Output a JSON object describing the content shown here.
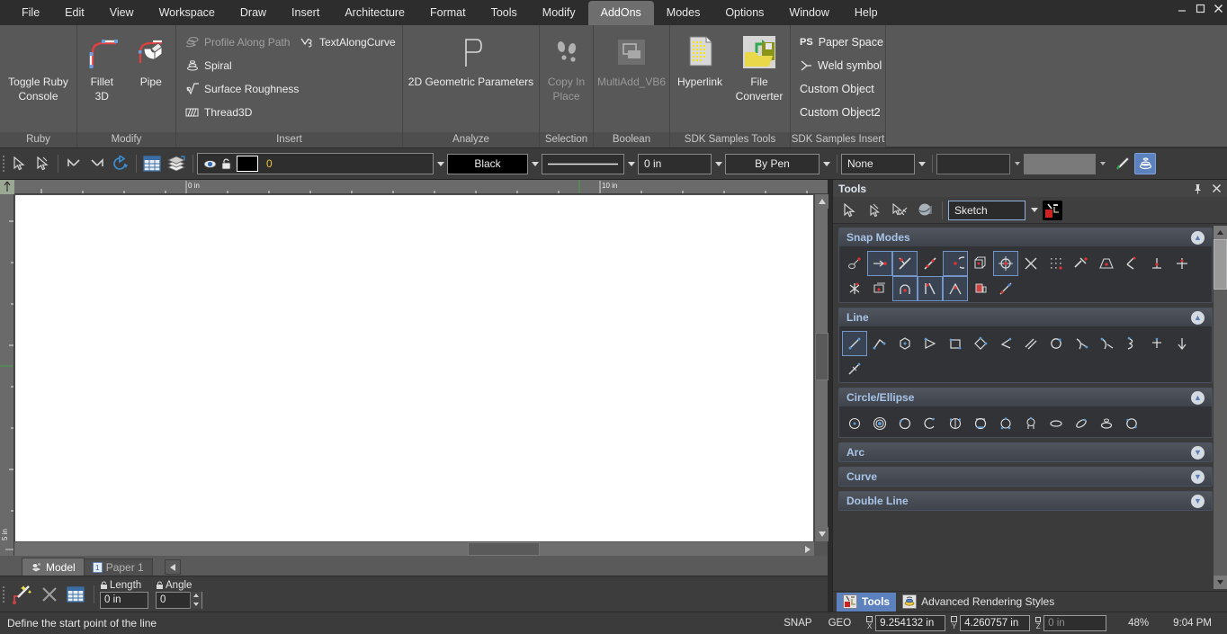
{
  "window": {
    "controls": [
      "minimize",
      "maximize",
      "close"
    ]
  },
  "menubar": {
    "items": [
      {
        "label": "File",
        "active": false
      },
      {
        "label": "Edit",
        "active": false
      },
      {
        "label": "View",
        "active": false
      },
      {
        "label": "Workspace",
        "active": false
      },
      {
        "label": "Draw",
        "active": false
      },
      {
        "label": "Insert",
        "active": false
      },
      {
        "label": "Architecture",
        "active": false
      },
      {
        "label": "Format",
        "active": false
      },
      {
        "label": "Tools",
        "active": false
      },
      {
        "label": "Modify",
        "active": false
      },
      {
        "label": "AddOns",
        "active": true
      },
      {
        "label": "Modes",
        "active": false
      },
      {
        "label": "Options",
        "active": false
      },
      {
        "label": "Window",
        "active": false
      },
      {
        "label": "Help",
        "active": false
      }
    ]
  },
  "ribbon": {
    "groups": [
      {
        "name": "Ruby",
        "label": "Ruby",
        "buttons": [
          {
            "label_line1": "Toggle Ruby",
            "label_line2": "Console",
            "icon": "ruby-console-icon",
            "enabled": true
          }
        ]
      },
      {
        "name": "Modify",
        "label": "Modify",
        "buttons": [
          {
            "label_line1": "Fillet",
            "label_line2": "3D",
            "icon": "fillet-3d-icon",
            "enabled": true
          },
          {
            "label_line1": "Pipe",
            "label_line2": "",
            "icon": "pipe-icon",
            "enabled": true
          }
        ]
      },
      {
        "name": "Insert",
        "label": "Insert",
        "items": [
          {
            "label": "Profile Along Path",
            "icon": "profile-along-path-icon",
            "enabled": false
          },
          {
            "label": "TextAlongCurve",
            "icon": "text-along-curve-icon",
            "enabled": true
          },
          {
            "label": "Spiral",
            "icon": "spiral-icon",
            "enabled": true
          },
          {
            "label": "Surface Roughness",
            "icon": "surface-roughness-icon",
            "enabled": true
          },
          {
            "label": "Thread3D",
            "icon": "thread3d-icon",
            "enabled": true
          }
        ]
      },
      {
        "name": "Analyze",
        "label": "Analyze",
        "buttons": [
          {
            "label_line1": "2D Geometric Parameters",
            "label_line2": "",
            "icon": "geometric-parameters-icon",
            "enabled": true
          }
        ]
      },
      {
        "name": "Selection",
        "label": "Selection",
        "buttons": [
          {
            "label_line1": "Copy In",
            "label_line2": "Place",
            "icon": "copy-in-place-icon",
            "enabled": false
          }
        ]
      },
      {
        "name": "Boolean",
        "label": "Boolean",
        "buttons": [
          {
            "label_line1": "MultiAdd_VB6",
            "label_line2": "",
            "icon": "multiadd-vb6-icon",
            "enabled": false
          }
        ]
      },
      {
        "name": "SDK Samples Tools",
        "label": "SDK Samples Tools",
        "buttons": [
          {
            "label_line1": "Hyperlink",
            "label_line2": "",
            "icon": "hyperlink-icon",
            "enabled": true
          },
          {
            "label_line1": "File",
            "label_line2": "Converter",
            "icon": "file-converter-icon",
            "enabled": true
          }
        ]
      },
      {
        "name": "SDK Samples Insert",
        "label": "SDK Samples Insert",
        "items": [
          {
            "label": "Paper Space",
            "icon": "paper-space-icon",
            "enabled": true
          },
          {
            "label": "Weld symbol",
            "icon": "weld-symbol-icon",
            "enabled": true
          },
          {
            "label": "Custom Object",
            "icon": "none",
            "enabled": true
          },
          {
            "label": "Custom Object2",
            "icon": "none",
            "enabled": true
          }
        ]
      }
    ]
  },
  "optionbar": {
    "icons": [
      "select-icon",
      "select-vertex-icon",
      "undo-icon",
      "redo-icon",
      "rotate-icon",
      "layers-table-icon",
      "layers-stack-icon"
    ],
    "layer_combo": {
      "value": "0",
      "eye_icon": "eye-icon",
      "lock_icon": "lock-icon"
    },
    "color_combo": {
      "value": "Black",
      "swatch": "#000000"
    },
    "linetype_combo": {
      "value": "solid-line"
    },
    "lineweight_combo": {
      "value": "0 in"
    },
    "linestyle_combo": {
      "value": "By Pen"
    },
    "hatch_combo": {
      "value": "None"
    },
    "textstyle_combo": {
      "value": ""
    },
    "extra_combo": {
      "value": ""
    },
    "pen_icon": "pen-icon",
    "render_icon": "render-icon"
  },
  "canvas": {
    "ruler_horizontal_labels": [
      "0 in",
      "10 in"
    ],
    "ruler_vertical_labels": [
      "5 in"
    ],
    "cursor_marker": "x-marker"
  },
  "doc_tabs": {
    "tabs": [
      {
        "label": "Model",
        "icon": "model-icon",
        "selected": true
      },
      {
        "label": "Paper 1",
        "icon": "paper-icon",
        "selected": false
      }
    ],
    "nav_icon": "prev-tab-icon"
  },
  "command_bar": {
    "icons": [
      "magic-wand-icon",
      "cancel-icon",
      "table-icon"
    ],
    "fields": [
      {
        "label": "Length",
        "value": "0 in",
        "lock_icon": "lock-icon",
        "spinner": false
      },
      {
        "label": "Angle",
        "value": "0",
        "lock_icon": "lock-icon",
        "spinner": true
      }
    ]
  },
  "status_bar": {
    "message": "Define the start point of the line",
    "tags": [
      "SNAP",
      "GEO"
    ],
    "coords": [
      {
        "axis": "X",
        "value": "9.254132 in",
        "dim": false
      },
      {
        "axis": "Y",
        "value": "4.260757 in",
        "dim": false
      },
      {
        "axis": "Z",
        "value": "0 in",
        "dim": true
      }
    ],
    "zoom": "48%",
    "time": "9:04 PM"
  },
  "dock": {
    "title": "Tools",
    "pin_icon": "pin-icon",
    "close_icon": "close-icon",
    "toolbar": {
      "icons": [
        "arrow-select-icon",
        "arrow-vertex-icon",
        "arrow-cross-icon",
        "sphere-icon"
      ],
      "mode_combo": {
        "value": "Sketch"
      },
      "tools_icon": "toolbox-icon"
    },
    "panels": [
      {
        "title": "Snap Modes",
        "expanded": true,
        "collapse_icon": "chevron-up-icon",
        "tools": [
          {
            "icon": "snap-none-icon",
            "active": false
          },
          {
            "icon": "snap-endpoint-icon",
            "active": true
          },
          {
            "icon": "snap-midpoint-icon",
            "active": true
          },
          {
            "icon": "snap-point-icon",
            "active": false
          },
          {
            "icon": "snap-center-icon",
            "active": true
          },
          {
            "icon": "snap-box-icon",
            "active": false
          },
          {
            "icon": "snap-quadrant-icon",
            "active": true
          },
          {
            "icon": "snap-intersection-icon",
            "active": false
          },
          {
            "icon": "snap-grid-icon",
            "active": false
          },
          {
            "icon": "snap-nearest-icon",
            "active": false
          },
          {
            "icon": "snap-insertion-icon",
            "active": false
          },
          {
            "icon": "snap-tangent-icon",
            "active": false
          },
          {
            "icon": "snap-perpendicular-icon",
            "active": false
          },
          {
            "icon": "snap-node-icon",
            "active": false
          },
          {
            "icon": "snap-star-icon",
            "active": false
          },
          {
            "icon": "snap-arrow-icon",
            "active": false
          },
          {
            "icon": "snap-arc-center-icon",
            "active": true
          },
          {
            "icon": "snap-corner-icon",
            "active": true
          },
          {
            "icon": "snap-apex-icon",
            "active": true
          },
          {
            "icon": "snap-face-icon",
            "active": false
          },
          {
            "icon": "snap-edge-icon",
            "active": false
          }
        ]
      },
      {
        "title": "Line",
        "expanded": true,
        "collapse_icon": "chevron-up-icon",
        "tools": [
          {
            "icon": "line-icon",
            "active": true
          },
          {
            "icon": "polyline-icon",
            "active": false
          },
          {
            "icon": "polygon-center-icon",
            "active": false
          },
          {
            "icon": "triangle-icon",
            "active": false
          },
          {
            "icon": "rectangle-icon",
            "active": false
          },
          {
            "icon": "rotated-rectangle-icon",
            "active": false
          },
          {
            "icon": "angle-line-icon",
            "active": false
          },
          {
            "icon": "parallel-line-icon",
            "active": false
          },
          {
            "icon": "circle-poly-icon",
            "active": false
          },
          {
            "icon": "tangent-line-icon",
            "active": false
          },
          {
            "icon": "tangent-line2-icon",
            "active": false
          },
          {
            "icon": "curve-line-icon",
            "active": false
          },
          {
            "icon": "cross-line-icon",
            "active": false
          },
          {
            "icon": "down-arrow-line-icon",
            "active": false
          },
          {
            "icon": "sketch-line-icon",
            "active": false
          }
        ]
      },
      {
        "title": "Circle/Ellipse",
        "expanded": true,
        "collapse_icon": "chevron-up-icon",
        "tools": [
          {
            "icon": "circle-center-icon",
            "active": false
          },
          {
            "icon": "concentric-circle-icon",
            "active": false
          },
          {
            "icon": "circle-2point-icon",
            "active": false
          },
          {
            "icon": "circle-arc-icon",
            "active": false
          },
          {
            "icon": "circle-diameter-icon",
            "active": false
          },
          {
            "icon": "circle-tangent-icon",
            "active": false
          },
          {
            "icon": "circle-3tangent-icon",
            "active": false
          },
          {
            "icon": "circle-tangent2-icon",
            "active": false
          },
          {
            "icon": "ellipse-icon",
            "active": false
          },
          {
            "icon": "ellipse-rotated-icon",
            "active": false
          },
          {
            "icon": "ellipse-arc-icon",
            "active": false
          },
          {
            "icon": "ellipse-center-icon",
            "active": false
          }
        ]
      },
      {
        "title": "Arc",
        "expanded": false,
        "collapse_icon": "chevron-down-icon",
        "tools": []
      },
      {
        "title": "Curve",
        "expanded": false,
        "collapse_icon": "chevron-down-icon",
        "tools": []
      },
      {
        "title": "Double Line",
        "expanded": false,
        "collapse_icon": "chevron-down-icon",
        "tools": []
      }
    ],
    "tabs": [
      {
        "label": "Tools",
        "icon": "toolbox-icon",
        "selected": true
      },
      {
        "label": "Advanced Rendering Styles",
        "icon": "render-styles-icon",
        "selected": false
      }
    ]
  },
  "colors": {
    "accent": "#5b81bf",
    "panel_header_text": "#a8c4e8",
    "ribbon_bg": "#585858",
    "canvas_bg": "#ffffff",
    "marker": "#ff00ff"
  }
}
